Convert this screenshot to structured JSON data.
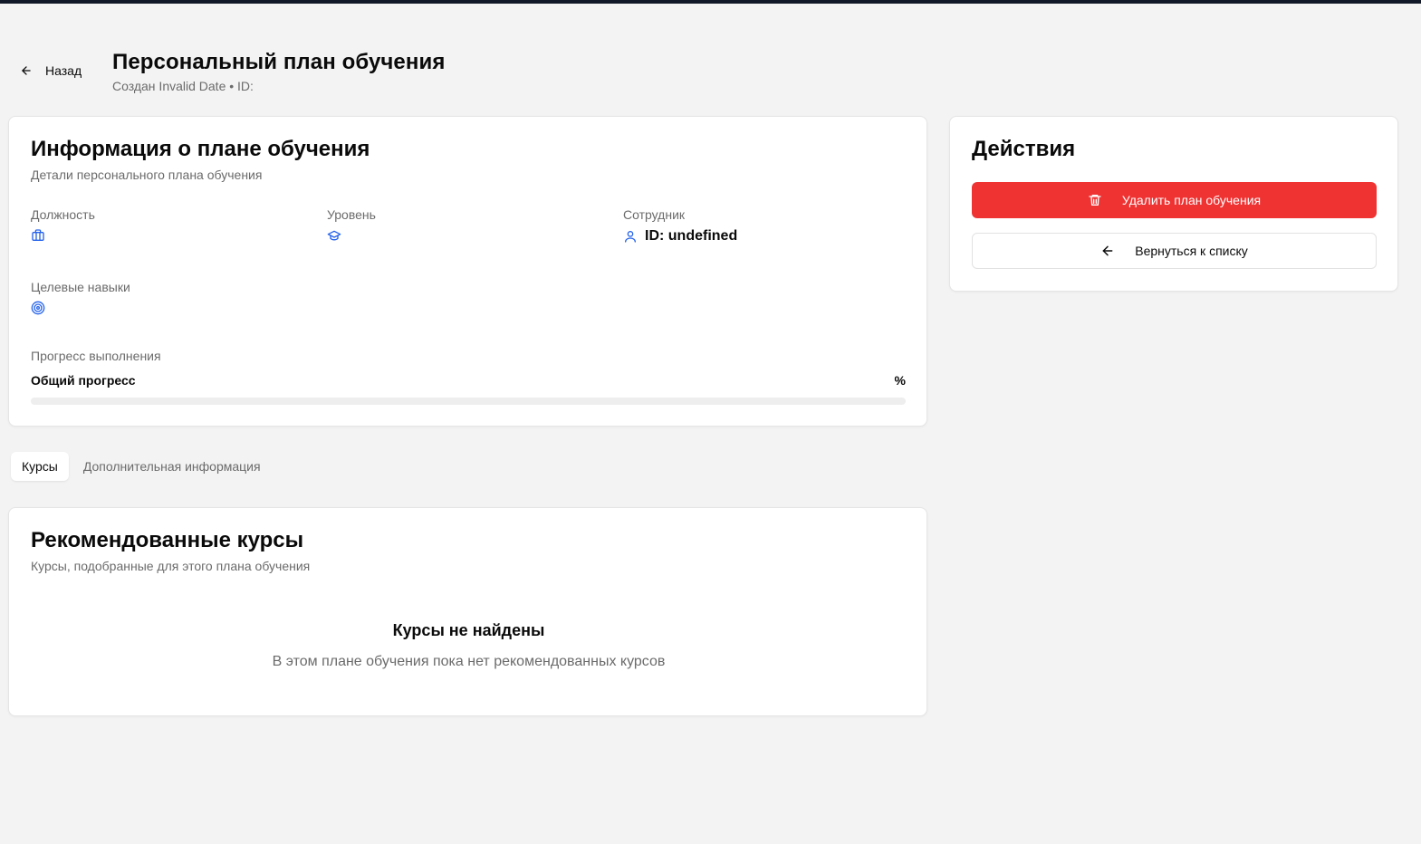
{
  "header": {
    "back_label": "Назад",
    "title": "Персональный план обучения",
    "meta": "Создан Invalid Date • ID:"
  },
  "info_card": {
    "title": "Информация о плане обучения",
    "subtitle": "Детали персонального плана обучения",
    "position": {
      "label": "Должность",
      "value": ""
    },
    "level": {
      "label": "Уровень",
      "value": ""
    },
    "employee": {
      "label": "Сотрудник",
      "value": "ID: undefined"
    },
    "skills": {
      "label": "Целевые навыки",
      "value": ""
    },
    "progress": {
      "label": "Прогресс выполнения",
      "overall_label": "Общий прогресс",
      "percent_text": "%",
      "value": 0
    }
  },
  "actions_card": {
    "title": "Действия",
    "delete_label": "Удалить план обучения",
    "return_label": "Вернуться к списку"
  },
  "tabs": [
    {
      "label": "Курсы",
      "active": true
    },
    {
      "label": "Дополнительная информация",
      "active": false
    }
  ],
  "courses_card": {
    "title": "Рекомендованные курсы",
    "subtitle": "Курсы, подобранные для этого плана обучения",
    "empty_title": "Курсы не найдены",
    "empty_text": "В этом плане обучения пока нет рекомендованных курсов"
  },
  "colors": {
    "accent_icon": "#2563eb",
    "danger": "#ef3333",
    "topbar": "#111827"
  },
  "icons": {
    "back": "arrow-left-icon",
    "position": "briefcase-icon",
    "level": "graduation-cap-icon",
    "employee": "user-icon",
    "skills": "target-icon",
    "delete": "trash-icon"
  }
}
